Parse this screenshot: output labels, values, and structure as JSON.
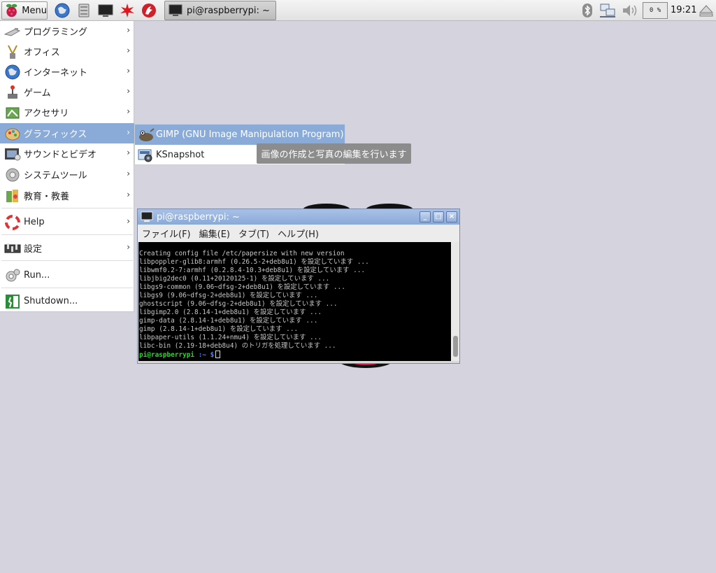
{
  "taskbar": {
    "menu_label": "Menu",
    "task_window_label": "pi@raspberrypi: ~",
    "cpu_usage": "0 %",
    "clock": "19:21",
    "icons": [
      "raspberry-icon",
      "web-browser-icon",
      "file-manager-icon",
      "terminal-icon",
      "wolfram-icon",
      "mathematica-icon",
      "bluetooth-icon",
      "network-icon",
      "volume-icon",
      "eject-icon"
    ]
  },
  "main_menu": {
    "items": [
      {
        "label": "プログラミング",
        "icon": "programming-icon",
        "has_submenu": true
      },
      {
        "label": "オフィス",
        "icon": "office-icon",
        "has_submenu": true
      },
      {
        "label": "インターネット",
        "icon": "internet-icon",
        "has_submenu": true
      },
      {
        "label": "ゲーム",
        "icon": "games-icon",
        "has_submenu": true
      },
      {
        "label": "アクセサリ",
        "icon": "accessories-icon",
        "has_submenu": true
      },
      {
        "label": "グラフィックス",
        "icon": "graphics-icon",
        "has_submenu": true,
        "active": true
      },
      {
        "label": "サウンドとビデオ",
        "icon": "sound-video-icon",
        "has_submenu": true
      },
      {
        "label": "システムツール",
        "icon": "system-tools-icon",
        "has_submenu": true
      },
      {
        "label": "教育・教養",
        "icon": "education-icon",
        "has_submenu": true
      },
      {
        "label": "Help",
        "icon": "help-icon",
        "has_submenu": true
      },
      {
        "label": "設定",
        "icon": "preferences-icon",
        "has_submenu": true
      },
      {
        "label": "Run...",
        "icon": "run-icon",
        "has_submenu": false
      },
      {
        "label": "Shutdown...",
        "icon": "shutdown-icon",
        "has_submenu": false
      }
    ],
    "arrow": "›"
  },
  "submenu": {
    "items": [
      {
        "label": "GIMP (GNU Image Manipulation Program)",
        "icon": "gimp-icon",
        "active": true
      },
      {
        "label": "KSnapshot",
        "icon": "ksnapshot-icon"
      }
    ]
  },
  "tooltip": "画像の作成と写真の編集を行います",
  "terminal": {
    "title": "pi@raspberrypi: ~",
    "window_buttons": [
      "_",
      "□",
      "×"
    ],
    "menus": [
      "ファイル(F)",
      "編集(E)",
      "タブ(T)",
      "ヘルプ(H)"
    ],
    "lines": [
      "Creating config file /etc/papersize with new version",
      "libpoppler-glib8:armhf (0.26.5-2+deb8u1) を設定しています ...",
      "libwmf0.2-7:armhf (0.2.8.4-10.3+deb8u1) を設定しています ...",
      "libjbig2dec0 (0.11+20120125-1) を設定しています ...",
      "libgs9-common (9.06~dfsg-2+deb8u1) を設定しています ...",
      "libgs9 (9.06~dfsg-2+deb8u1) を設定しています ...",
      "ghostscript (9.06~dfsg-2+deb8u1) を設定しています ...",
      "libgimp2.0 (2.8.14-1+deb8u1) を設定しています ...",
      "gimp-data (2.8.14-1+deb8u1) を設定しています ...",
      "gimp (2.8.14-1+deb8u1) を設定しています ...",
      "libpaper-utils (1.1.24+nmu4) を設定しています ...",
      "libc-bin (2.19-18+deb8u4) のトリガを処理しています ..."
    ],
    "prompt_user": "pi@raspberrypi",
    "prompt_path": ":~ $"
  },
  "colors": {
    "desktop": "#d5d3dd",
    "menu_highlight": "#8aabd8",
    "terminal_bg": "#000000",
    "prompt_green": "#22dd22",
    "prompt_blue": "#5b7bff"
  }
}
